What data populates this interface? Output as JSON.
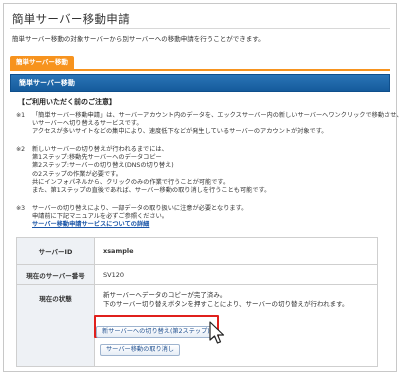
{
  "page": {
    "title": "簡単サーバー移動申請",
    "description": "簡単サーバー移動の対象サーバーから別サーバーへの移動申請を行うことができます。"
  },
  "tab": {
    "label": "簡単サーバー移動"
  },
  "section": {
    "title": "簡単サーバー移動"
  },
  "notice": {
    "heading": "【ご利用いただく前のご注意】",
    "items": [
      {
        "mark": "※1",
        "lines": [
          "「簡単サーバー移動申請」は、サーバーアカウント内のデータを、エックスサーバー内の新しいサーバーへワンクリックで移動させ、新し",
          "いサーバーへ切り替えるサービスです。",
          "アクセスが多いサイトなどの集中により、速度低下などが発生しているサーバーのアカウントが対象です。"
        ]
      },
      {
        "mark": "※2",
        "lines": [
          "新しいサーバーの切り替えが行われるまでには、",
          "第1ステップ:移動先サーバーへのデータコピー",
          "第2ステップ:サーバーの切り替え(DNSの切り替え)",
          "の2ステップの作業が必要です。",
          "共にインフォパネルから、クリックのみの作業で行うことが可能です。",
          "また、第1ステップの直後であれば、サーバー移動の取り消しを行うことも可能です。"
        ]
      },
      {
        "mark": "※3",
        "lines": [
          "サーバーの切り替えにより、一部データの取り扱いに注意が必要となります。",
          "申請前に下記マニュアルを必ずご参照ください。"
        ],
        "link": "サーバー移動申請サービスについての詳細"
      }
    ]
  },
  "info_table": {
    "server_id_label": "サーバーID",
    "server_id_value": "xsample",
    "server_num_label": "現在のサーバー番号",
    "server_num_value": "SV120",
    "status_label": "現在の状態",
    "status_lines": [
      "新サーバーへデータのコピーが完了済み。",
      "下のサーバー切り替えボタンを押すことにより、サーバーの切り替えが行われます。"
    ]
  },
  "buttons": {
    "switch_label": "新サーバーへの切り替え(第2ステップ)",
    "cancel_label": "サーバー移動の取り消し"
  },
  "colors": {
    "tab_orange": "#f7931e",
    "section_blue": "#1a66a8",
    "highlight_red": "#e0201c",
    "link_blue": "#1a55a8"
  }
}
